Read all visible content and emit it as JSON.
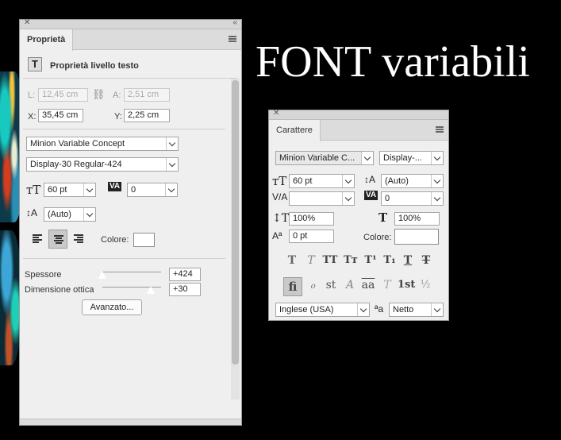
{
  "headline": "FONT variabili",
  "properties_panel": {
    "tab": "Proprietà",
    "section_title": "Proprietà livello testo",
    "l_label": "L:",
    "l_value": "12,45 cm",
    "a_label": "A:",
    "a_value": "2,51 cm",
    "x_label": "X:",
    "x_value": "35,45 cm",
    "y_label": "Y:",
    "y_value": "2,25 cm",
    "font_family": "Minion Variable Concept",
    "font_style": "Display-30 Regular-424",
    "font_size": "60 pt",
    "tracking": "0",
    "leading": "(Auto)",
    "color_label": "Colore:",
    "weight_label": "Spessore",
    "weight_value": "+424",
    "weight_level": 0.0,
    "optical_label": "Dimensione ottica",
    "optical_value": "+30",
    "optical_level": 0.82,
    "advanced_button": "Avanzato..."
  },
  "character_panel": {
    "tab": "Carattere",
    "font_family": "Minion Variable C...",
    "font_style": "Display-...",
    "font_size": "60 pt",
    "leading": "(Auto)",
    "kerning": "",
    "tracking": "0",
    "vertical_scale": "100%",
    "horizontal_scale": "100%",
    "baseline_shift": "0 pt",
    "color_label": "Colore:",
    "language": "Inglese (USA)",
    "antialias": "Netto",
    "style_glyphs": [
      "T",
      "T",
      "TT",
      "Tт",
      "T¹",
      "T₁",
      "T",
      "T"
    ],
    "opentype_glyphs": [
      "fi",
      "ℴ",
      "st",
      "A",
      "aa",
      "T",
      "1st",
      "½"
    ]
  },
  "colors": {
    "panel_bg": "#efefef",
    "background": "#000000",
    "text": "#ffffff"
  }
}
